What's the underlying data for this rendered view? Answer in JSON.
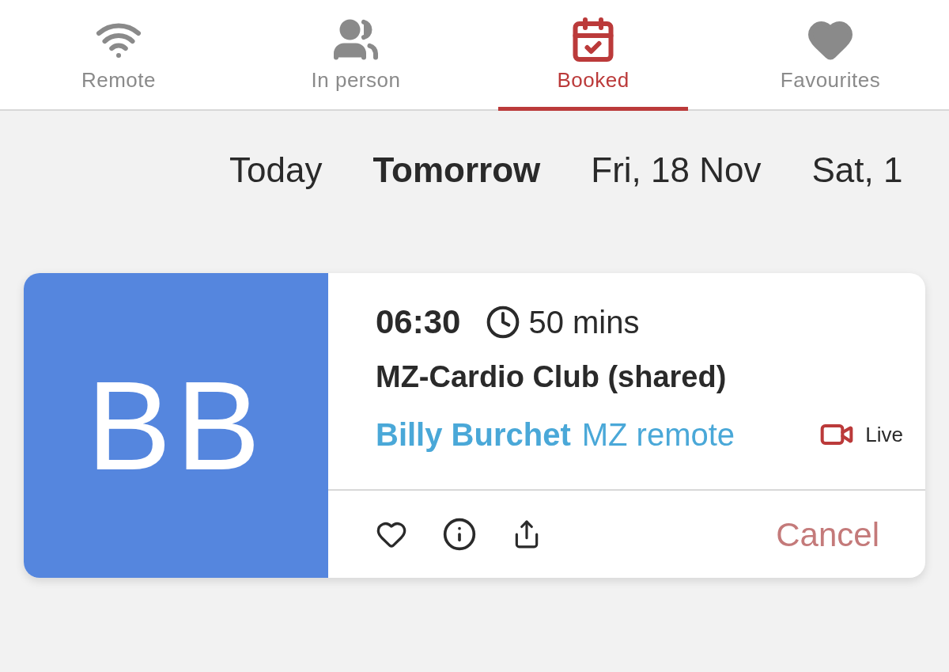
{
  "tabs": [
    {
      "label": "Remote",
      "selected": false
    },
    {
      "label": "In person",
      "selected": false
    },
    {
      "label": "Booked",
      "selected": true
    },
    {
      "label": "Favourites",
      "selected": false
    }
  ],
  "dates": [
    {
      "label": "Today",
      "selected": false
    },
    {
      "label": "Tomorrow",
      "selected": true
    },
    {
      "label": "Fri, 18 Nov",
      "selected": false
    },
    {
      "label": "Sat, 1",
      "selected": false
    }
  ],
  "booking": {
    "initials": "BB",
    "time": "06:30",
    "duration": "50 mins",
    "title": "MZ-Cardio Club (shared)",
    "instructor": "Billy Burchet",
    "location": "MZ remote",
    "live": "Live",
    "cancel": "Cancel"
  }
}
